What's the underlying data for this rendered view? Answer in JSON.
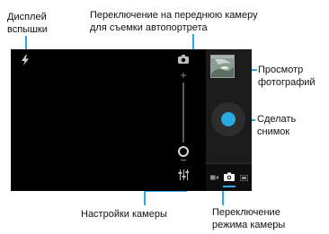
{
  "callouts": {
    "flash": [
      "Дисплей",
      "вспышки"
    ],
    "front_camera": [
      "Переключение на переднюю камеру",
      "для съемки автопортрета"
    ],
    "gallery": [
      "Просмотр",
      "фотографий"
    ],
    "shutter": [
      "Сделать",
      "снимок"
    ],
    "settings": [
      "Настройки камеры"
    ],
    "mode": [
      "Переключение",
      "режима камеры"
    ]
  },
  "icons": {
    "flash": "flash-icon",
    "front_camera": "switch-camera-icon",
    "zoom_in": "zoom-plus-icon",
    "zoom_out": "zoom-minus-icon",
    "settings": "settings-sliders-icon",
    "gallery": "gallery-thumbnail",
    "shutter": "shutter-button",
    "video": "video-mode-icon",
    "photo": "photo-mode-icon",
    "panorama": "panorama-mode-icon"
  },
  "colors": {
    "accent": "#29a9e0",
    "screen": "#000000",
    "panel": "#1b1b1b"
  },
  "zoom": {
    "level": 0.0
  }
}
